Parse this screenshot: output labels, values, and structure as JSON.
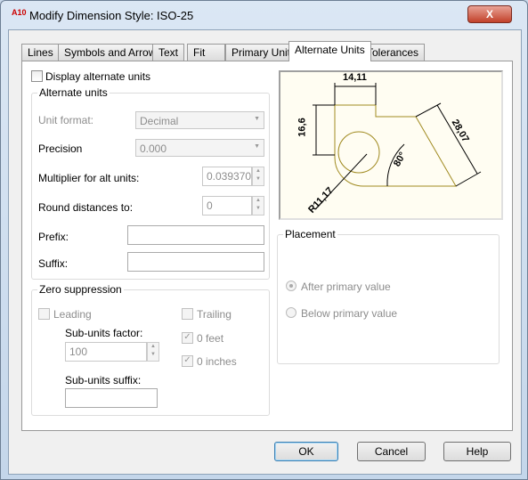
{
  "window": {
    "title": "Modify Dimension Style: ISO-25",
    "app_icon": "A10",
    "close": "X"
  },
  "tabs": [
    "Lines",
    "Symbols and Arrows",
    "Text",
    "Fit",
    "Primary Units",
    "Alternate Units",
    "Tolerances"
  ],
  "active_tab": "Alternate Units",
  "display_alt": {
    "label": "Display alternate units",
    "checked": false
  },
  "alt_units": {
    "legend": "Alternate units",
    "unit_format_label": "Unit format:",
    "unit_format": "Decimal",
    "precision_label": "Precision",
    "precision": "0.000",
    "multiplier_label": "Multiplier for alt units:",
    "multiplier": "0.0393700",
    "round_label": "Round distances  to:",
    "round": "0",
    "prefix_label": "Prefix:",
    "prefix": "",
    "suffix_label": "Suffix:",
    "suffix": ""
  },
  "zero": {
    "legend": "Zero suppression",
    "leading": "Leading",
    "trailing": "Trailing",
    "sub_factor_label": "Sub-units factor:",
    "sub_factor": "100",
    "feet": "0 feet",
    "inches": "0 inches",
    "sub_suffix_label": "Sub-units suffix:",
    "sub_suffix": ""
  },
  "preview": {
    "dim_top": "14,11",
    "dim_left": "16,6",
    "dim_diag": "28,07",
    "angle": "80°",
    "radius": "R11,17"
  },
  "placement": {
    "legend": "Placement",
    "after": "After primary value",
    "below": "Below primary value",
    "selected": "after"
  },
  "buttons": {
    "ok": "OK",
    "cancel": "Cancel",
    "help": "Help"
  }
}
